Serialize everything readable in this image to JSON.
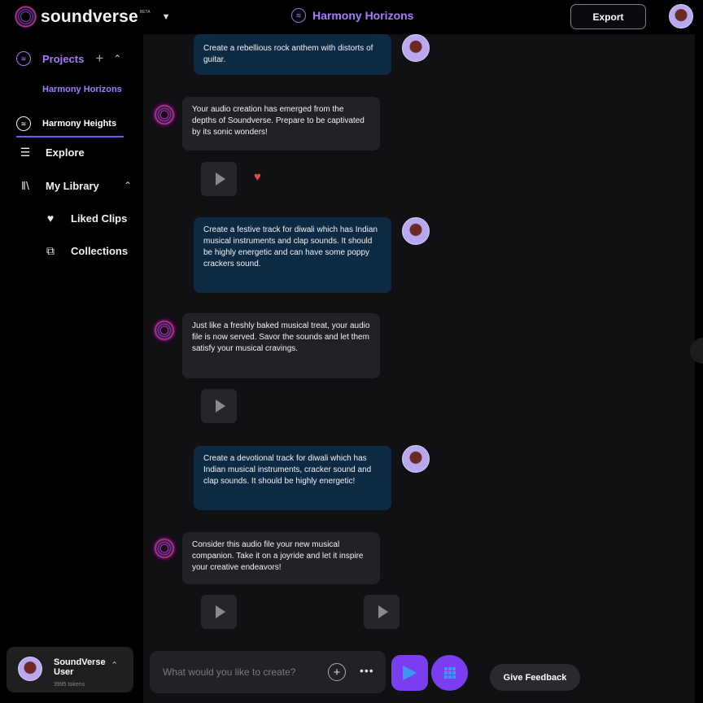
{
  "header": {
    "brand": "soundverse",
    "beta": "BETA",
    "brand_menu_icon": "chevron-down-icon",
    "project_title": "Harmony Horizons",
    "export_label": "Export"
  },
  "sidebar": {
    "projects_label": "Projects",
    "project_items": [
      {
        "label": "Harmony Horizons",
        "active": true
      },
      {
        "label": "Harmony Heights",
        "active": false
      }
    ],
    "explore_label": "Explore",
    "library_label": "My Library",
    "liked_label": "Liked Clips",
    "collections_label": "Collections",
    "user": {
      "name": "SoundVerse User",
      "tokens": "3995 tokens"
    }
  },
  "chat": {
    "messages": [
      {
        "role": "user",
        "text": "Create a rebellious rock anthem with distorts of guitar."
      },
      {
        "role": "bot",
        "text": "Your audio creation has emerged from the depths of Soundverse. Prepare to be captivated by its sonic wonders!"
      },
      {
        "role": "user",
        "text": "Create a festive track for diwali which has Indian musical instruments and clap sounds. It should be highly energetic and can have some poppy crackers sound."
      },
      {
        "role": "bot",
        "text": "Just like a freshly baked musical treat, your audio file is now served. Savor the sounds and let them satisfy your musical cravings."
      },
      {
        "role": "user",
        "text": "Create a devotional track for diwali which has Indian musical instruments, cracker sound and clap sounds. It should be highly energetic!"
      },
      {
        "role": "bot",
        "text": "Consider this audio file your new musical companion. Take it on a joyride and let it inspire your creative endeavors!"
      }
    ]
  },
  "composer": {
    "placeholder": "What would you like to create?",
    "add_icon": "plus-icon",
    "more_icon": "more-dots-icon",
    "send_icon": "send-icon",
    "apps_icon": "grid-icon",
    "feedback_label": "Give Feedback"
  },
  "colors": {
    "accent": "#a57cff",
    "user_bubble": "#0d2a45",
    "bot_bubble": "#222226",
    "send": "#7a3df0"
  }
}
